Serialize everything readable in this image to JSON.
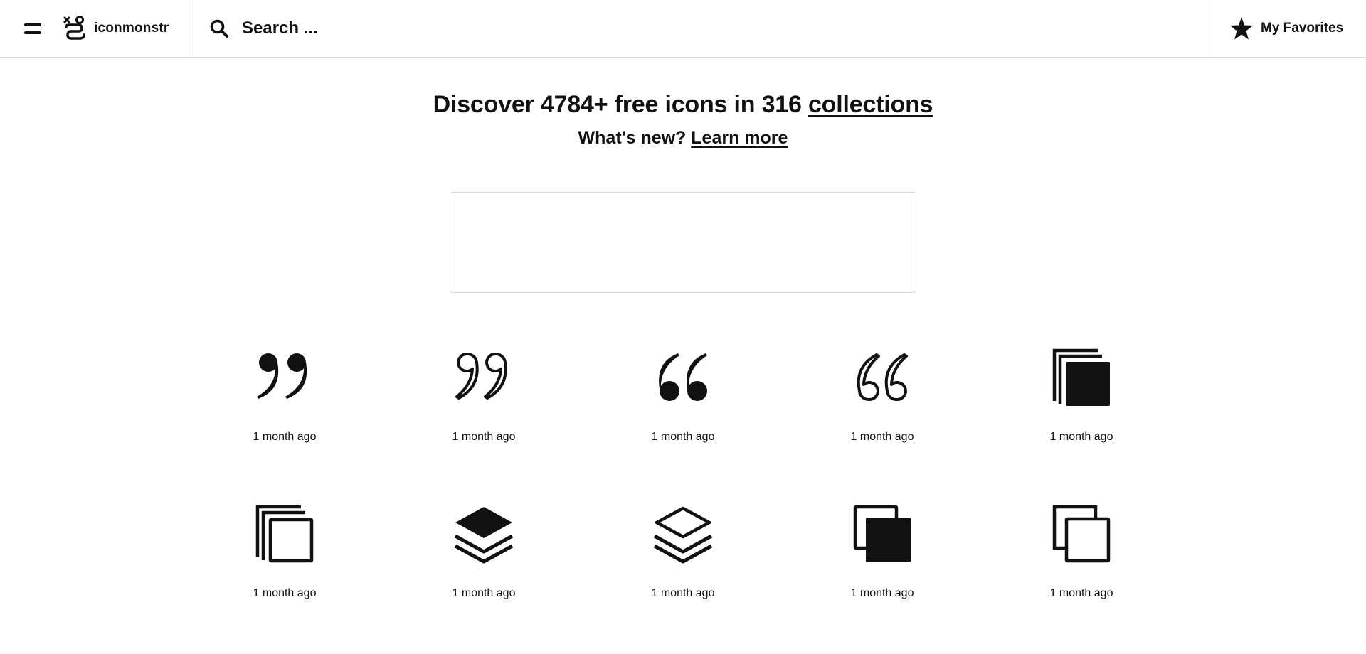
{
  "header": {
    "brand_name": "iconmonstr",
    "search_placeholder": "Search ...",
    "favorites_label": "My Favorites"
  },
  "hero": {
    "title_prefix": "Discover 4784+ free icons in 316 ",
    "title_link": "collections",
    "sub_prefix": "What's new? ",
    "sub_link": "Learn more"
  },
  "icons": [
    {
      "icon": "quote-right-filled-icon",
      "time": "1 month ago"
    },
    {
      "icon": "quote-right-outline-icon",
      "time": "1 month ago"
    },
    {
      "icon": "quote-left-filled-icon",
      "time": "1 month ago"
    },
    {
      "icon": "quote-left-outline-icon",
      "time": "1 month ago"
    },
    {
      "icon": "layers-stack-filled-icon",
      "time": "1 month ago"
    },
    {
      "icon": "layers-stack-outline-icon",
      "time": "1 month ago"
    },
    {
      "icon": "stack-layers-filled-icon",
      "time": "1 month ago"
    },
    {
      "icon": "stack-layers-outline-icon",
      "time": "1 month ago"
    },
    {
      "icon": "copy-filled-icon",
      "time": "1 month ago"
    },
    {
      "icon": "copy-outline-icon",
      "time": "1 month ago"
    }
  ],
  "colors": {
    "text": "#111111",
    "border": "#d8d8d8",
    "background": "#ffffff"
  }
}
